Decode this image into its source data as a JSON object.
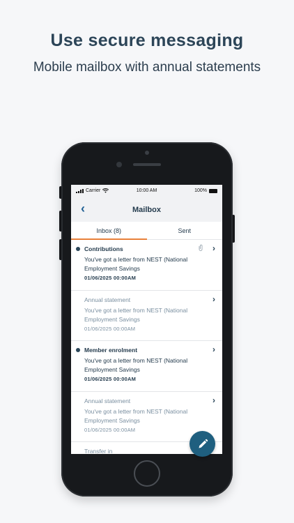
{
  "headline": "Use secure messaging",
  "subline": "Mobile mailbox with annual statements",
  "statusbar": {
    "carrier": "Carrier",
    "time": "10:00 AM",
    "battery": "100%"
  },
  "navbar": {
    "title": "Mailbox",
    "back_icon": "chevron-left-icon"
  },
  "tabs": {
    "inbox": "Inbox (8)",
    "sent": "Sent"
  },
  "messages": [
    {
      "subject": "Contributions",
      "body": "You've got a letter from NEST (National Employment Savings",
      "date": "01/06/2025 00:00AM",
      "unread": true,
      "attachment": true
    },
    {
      "subject": "Annual statement",
      "body": "You've got a letter from NEST (National Employment Savings",
      "date": "01/06/2025 00:00AM",
      "unread": false,
      "attachment": false
    },
    {
      "subject": "Member enrolment",
      "body": "You've got a letter from NEST (National Employment Savings",
      "date": "01/06/2025 00:00AM",
      "unread": true,
      "attachment": false
    },
    {
      "subject": "Annual statement",
      "body": "You've got a letter from NEST (National Employment Savings",
      "date": "01/06/2025 00:00AM",
      "unread": false,
      "attachment": false
    },
    {
      "subject": "Transfer in",
      "body": "",
      "date": "",
      "unread": false,
      "attachment": false
    }
  ],
  "fab": {
    "icon": "pencil-icon"
  },
  "colors": {
    "accent": "#e8803a",
    "primary": "#1f5f7f",
    "text": "#243b4d",
    "muted": "#7a8fa0"
  }
}
